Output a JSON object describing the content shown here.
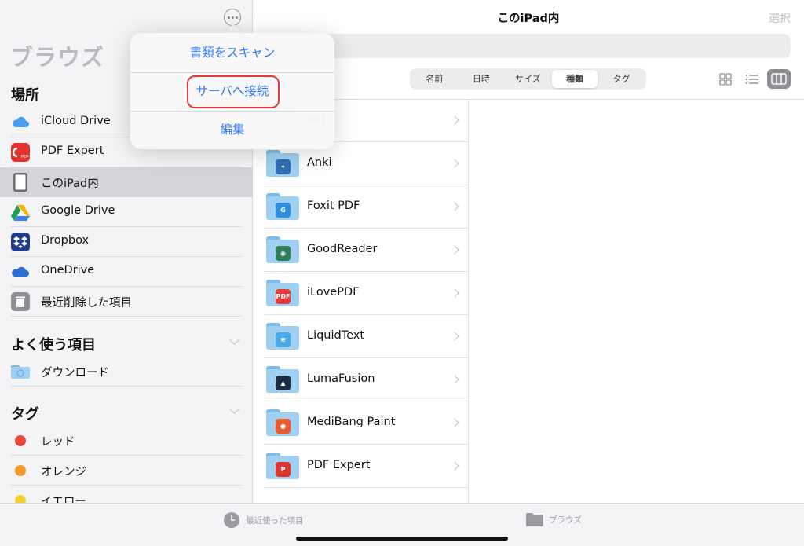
{
  "sidebar": {
    "title": "ブラウズ",
    "sections": {
      "locations": "場所",
      "favorites": "よく使う項目",
      "tags": "タグ"
    },
    "locations": [
      {
        "label": "iCloud Drive",
        "icon": "icloud-icon"
      },
      {
        "label": "PDF Expert",
        "icon": "pdf-expert-icon"
      },
      {
        "label": "このiPad内",
        "icon": "ipad-icon",
        "selected": true
      },
      {
        "label": "Google Drive",
        "icon": "google-drive-icon"
      },
      {
        "label": "Dropbox",
        "icon": "dropbox-icon"
      },
      {
        "label": "OneDrive",
        "icon": "onedrive-icon"
      },
      {
        "label": "最近削除した項目",
        "icon": "trash-icon"
      }
    ],
    "favorites": [
      {
        "label": "ダウンロード",
        "icon": "download-folder-icon"
      }
    ],
    "tags": [
      {
        "label": "レッド",
        "color": "#e9493d"
      },
      {
        "label": "オレンジ",
        "color": "#f09a2e"
      },
      {
        "label": "イエロー",
        "color": "#f5cf2c"
      }
    ]
  },
  "popover": {
    "items": [
      "書類をスキャン",
      "サーバへ接続",
      "編集"
    ],
    "highlighted_item": "サーバへ接続"
  },
  "main": {
    "title": "このiPad内",
    "select_label": "選択",
    "sort_tabs": [
      "名前",
      "日時",
      "サイズ",
      "種類",
      "タグ"
    ],
    "active_sort": "種類",
    "view_modes": [
      "grid",
      "list",
      "columns"
    ],
    "active_view": "columns",
    "folders": [
      {
        "name": "oat",
        "badge": "",
        "badge_color": "#6e6e73"
      },
      {
        "name": "Anki",
        "badge": "✦",
        "badge_color": "#2f6fb3"
      },
      {
        "name": "Foxit PDF",
        "badge": "G",
        "badge_color": "#2d8ee0"
      },
      {
        "name": "GoodReader",
        "badge": "◉",
        "badge_color": "#2e7d5b"
      },
      {
        "name": "iLovePDF",
        "badge": "PDF",
        "badge_color": "#e43a3a"
      },
      {
        "name": "LiquidText",
        "badge": "≡",
        "badge_color": "#4aa8e6"
      },
      {
        "name": "LumaFusion",
        "badge": "▲",
        "badge_color": "#1d2a44"
      },
      {
        "name": "MediBang Paint",
        "badge": "●",
        "badge_color": "#e85c2e"
      },
      {
        "name": "PDF Expert",
        "badge": "P",
        "badge_color": "#e0342d"
      }
    ]
  },
  "tabbar": {
    "recents": "最近使った項目",
    "browse": "ブラウズ"
  },
  "colors": {
    "accent": "#3478f6",
    "highlight_circle": "#e23b3b",
    "folder": "#9fd0f2"
  }
}
